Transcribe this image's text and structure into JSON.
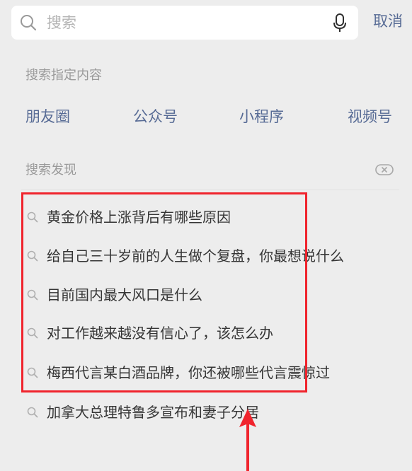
{
  "search": {
    "placeholder": "搜索",
    "cancel_label": "取消"
  },
  "specify_section": {
    "title": "搜索指定内容",
    "categories": [
      "朋友圈",
      "公众号",
      "小程序",
      "视频号"
    ]
  },
  "discover_section": {
    "title": "搜索发现",
    "items": [
      "黄金价格上涨背后有哪些原因",
      "给自己三十岁前的人生做个复盘，你最想说什么",
      "目前国内最大风口是什么",
      "对工作越来越没有信心了，该怎么办",
      "梅西代言某白酒品牌，你还被哪些代言震惊过",
      "加拿大总理特鲁多宣布和妻子分居"
    ]
  },
  "colors": {
    "background": "#ededed",
    "link_blue": "#576b95",
    "highlight_red": "#f0242d"
  },
  "icons": [
    "search-icon",
    "microphone-icon",
    "clear-icon",
    "arrow-up-icon"
  ]
}
